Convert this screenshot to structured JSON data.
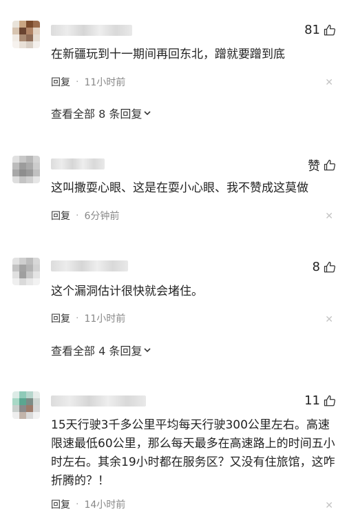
{
  "comments": [
    {
      "likes": "81",
      "text": "在新疆玩到十一期间再回东北，蹭就要蹭到底",
      "reply_label": "回复",
      "time": "11小时前",
      "more_replies": "查看全部 8 条回复",
      "avatar_colors": [
        "#e9e3da",
        "#c9a582",
        "#7a4a2c",
        "#9b6d4e",
        "#d7c4b0",
        "#6a4430",
        "#b08466",
        "#e2d3c4",
        "#f1ebe4",
        "#a98a72",
        "#8d6a55",
        "#e6ddd3",
        "#f6f2ee",
        "#e8e0d7",
        "#d9cfc5",
        "#f4f0ec"
      ]
    },
    {
      "likes": "赞",
      "text": "这叫撒耍心眼、这是在耍小心眼、我不赞成这莫做",
      "reply_label": "回复",
      "time": "6分钟前",
      "avatar_colors": [
        "#e0e0e0",
        "#c8c8c8",
        "#b8b8b8",
        "#d4d4d4",
        "#bcbcbc",
        "#9c9c9c",
        "#aaaaaa",
        "#cccccc",
        "#a8a8a8",
        "#8e8e8e",
        "#9a9a9a",
        "#c0c0c0",
        "#dedede",
        "#c4c4c4",
        "#d0d0d0",
        "#e6e6e6"
      ]
    },
    {
      "likes": "8",
      "text": "这个漏洞估计很快就会堵住。",
      "reply_label": "回复",
      "time": "11小时前",
      "more_replies": "查看全部 4 条回复",
      "avatar_colors": [
        "#e2e2e2",
        "#cfcfcf",
        "#bdbdbd",
        "#d8d8d8",
        "#c3c3c3",
        "#a3a3a3",
        "#b3b3b3",
        "#d2d2d2",
        "#e0e0e0",
        "#9f9f9f",
        "#c7c7c7",
        "#e4e4e4",
        "#efefef",
        "#dadada",
        "#e8e8e8",
        "#f2f2f2"
      ]
    },
    {
      "likes": "11",
      "text": "15天行驶3千多公里平均每天行驶300公里左右。高速限速最低60公里，那么每天最多在高速路上的时间五小时左右。其余19小时都在服务区？又没有住旅馆，这咋折腾的？！",
      "reply_label": "回复",
      "time": "14小时前",
      "avatar_colors": [
        "#dcebe6",
        "#8fcab8",
        "#b6d6cc",
        "#e6ece9",
        "#a8d8c6",
        "#5aa690",
        "#7c8c86",
        "#cfd6d3",
        "#c9cfcc",
        "#8a8a8a",
        "#9c7a6a",
        "#d6d6d6",
        "#eeeeee",
        "#c2b4aa",
        "#dadada",
        "#f2f2f2"
      ]
    }
  ]
}
